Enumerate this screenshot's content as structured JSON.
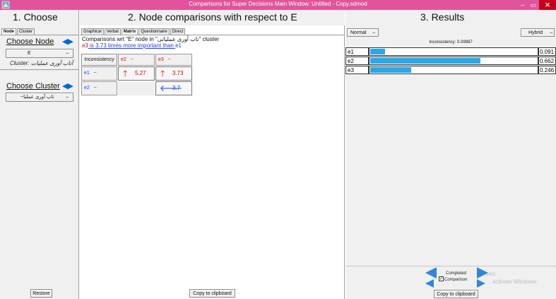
{
  "window": {
    "title": "Comparisons for Super Decisions Main Window: Untitled - Copy.sdmod",
    "min": "–",
    "max": "▭",
    "close": "✕"
  },
  "panel1": {
    "heading": "1. Choose",
    "tabs": [
      "Node",
      "Cluster"
    ],
    "choose_node_label": "Choose Node",
    "node_value": "E",
    "cluster_text": "Cluster: آتاب آوری عملیات",
    "choose_cluster_label": "Choose Cluster",
    "cluster_value": "~تاب آوری عملیا",
    "restore": "Restore"
  },
  "panel2": {
    "heading": "2. Node comparisons with respect to E",
    "tabs": [
      "Graphical",
      "Verbal",
      "Matrix",
      "Questionnaire",
      "Direct"
    ],
    "line1": "Comparisons wrt \"E\" node in \"تاب آوری عملیاتی\" cluster",
    "line2_a": "e3",
    "line2_b": " is 3.73 times more important than ",
    "line2_c": "e1",
    "inconsistency_btn": "Inconsistency",
    "col_e2": "e2",
    "col_e3": "e3",
    "tilde": "~",
    "row_e1": "e1",
    "row_e2": "e2",
    "v_e1_e2": "5.27",
    "v_e1_e3": "3.73",
    "v_e2_e3": "3.7",
    "copy": "Copy to clipboard"
  },
  "panel3": {
    "heading": "3. Results",
    "normal": "Normal",
    "hybrid": "Hybrid",
    "inconsistency": "Inconsistency: 0.09987",
    "rows": [
      {
        "name": "e1",
        "value": "0.091",
        "fraction": 0.091
      },
      {
        "name": "e2",
        "value": "0.662",
        "fraction": 0.662
      },
      {
        "name": "e3",
        "value": "0.246",
        "fraction": 0.246
      }
    ],
    "completed": "Completed",
    "comparison": "Comparison",
    "copy": "Copy to clipboard",
    "watermark1": "ows",
    "watermark2": "activate Windows."
  },
  "colors": {
    "title_bar": "#e0549c",
    "bar": "#29a7e9",
    "accent_red": "#e00000",
    "accent_blue": "#1a3cff"
  }
}
